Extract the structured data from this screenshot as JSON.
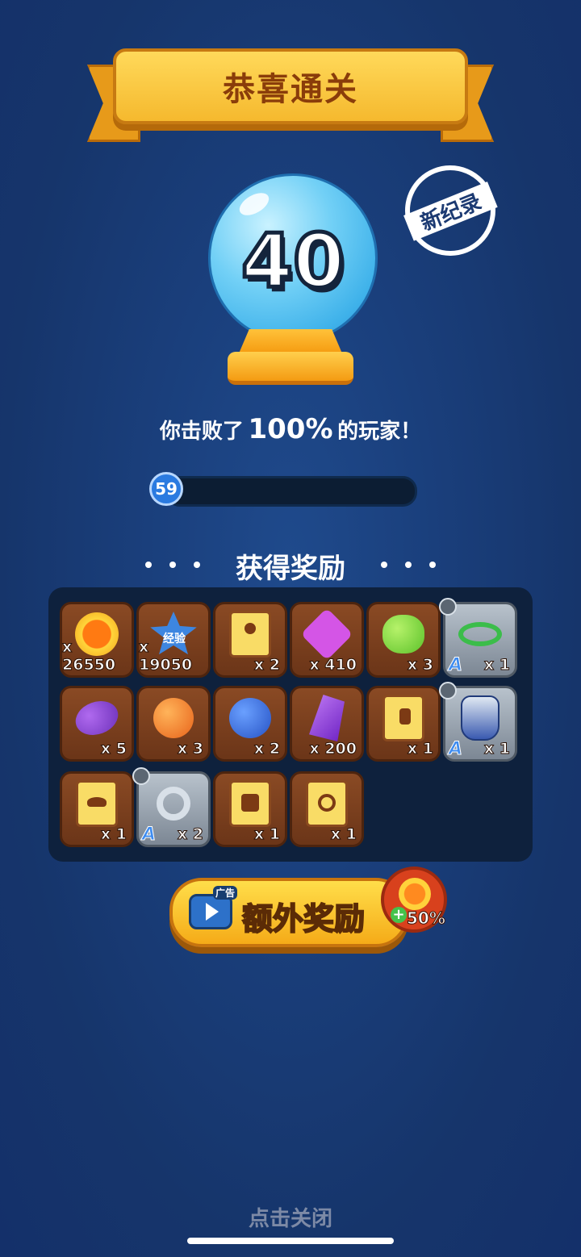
{
  "banner": {
    "title": "恭喜通关"
  },
  "score": {
    "value": "40"
  },
  "record_stamp": {
    "label": "新纪录"
  },
  "defeat": {
    "prefix": "你击败了",
    "percent": "100%",
    "suffix": "的玩家！"
  },
  "progress": {
    "level": "59",
    "fill_fraction": 0.03
  },
  "rewards": {
    "title": "获得奖励",
    "items": [
      {
        "icon": "gold-coin-icon",
        "qty": "x 26550"
      },
      {
        "icon": "exp-star-icon",
        "label": "经验",
        "qty": "x 19050"
      },
      {
        "icon": "weapon-scroll-icon",
        "qty": "x 2"
      },
      {
        "icon": "purple-gem-icon",
        "qty": "x 410"
      },
      {
        "icon": "green-fruit-icon",
        "qty": "x 3"
      },
      {
        "icon": "laurel-wreath-icon",
        "grade": "A",
        "qty": "x 1"
      },
      {
        "icon": "eggplant-icon",
        "qty": "x 5"
      },
      {
        "icon": "orange-fruit-icon",
        "qty": "x 3"
      },
      {
        "icon": "grapes-icon",
        "qty": "x 2"
      },
      {
        "icon": "purple-crystal-icon",
        "qty": "x 200"
      },
      {
        "icon": "glove-scroll-icon",
        "qty": "x 1"
      },
      {
        "icon": "armor-icon",
        "grade": "A",
        "qty": "x 1"
      },
      {
        "icon": "hat-scroll-icon",
        "qty": "x 1"
      },
      {
        "icon": "ring-icon",
        "grade": "A",
        "qty": "x 2"
      },
      {
        "icon": "shirt-scroll-icon",
        "qty": "x 1"
      },
      {
        "icon": "ring-scroll-icon",
        "qty": "x 1"
      }
    ]
  },
  "extra_reward": {
    "ad_tag": "广告",
    "label": "额外奖励",
    "bonus": "50%"
  },
  "close_hint": "点击关闭"
}
